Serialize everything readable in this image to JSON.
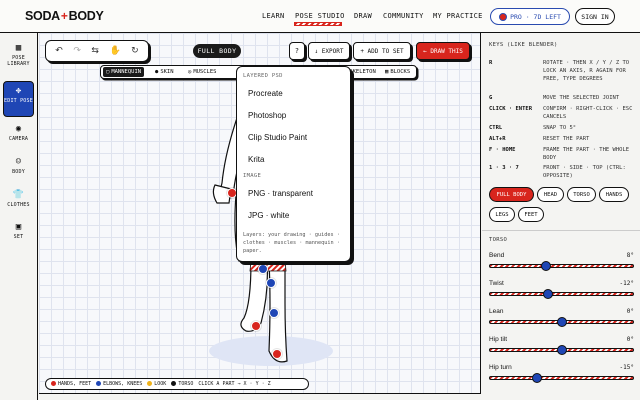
{
  "app": {
    "logo_left": "SODA",
    "logo_plus": "+",
    "logo_right": "BODY"
  },
  "nav": [
    "LEARN",
    "POSE STUDIO",
    "DRAW",
    "COMMUNITY",
    "MY PRACTICE"
  ],
  "nav_active": "POSE STUDIO",
  "pro_badge": "PRO · 7D LEFT",
  "sign_in": "SIGN IN",
  "sidebar": [
    {
      "icon": "grid-icon",
      "glyph": "▦",
      "label": "POSE LIBRARY"
    },
    {
      "icon": "move-icon",
      "glyph": "✥",
      "label": "EDIT POSE",
      "active": true
    },
    {
      "icon": "camera-icon",
      "glyph": "◉",
      "label": "CAMERA"
    },
    {
      "icon": "body-icon",
      "glyph": "☺",
      "label": "BODY"
    },
    {
      "icon": "clothes-icon",
      "glyph": "👕",
      "label": "CLOTHES"
    },
    {
      "icon": "set-icon",
      "glyph": "▣",
      "label": "SET"
    }
  ],
  "toolbox": {
    "undo": "↶",
    "redo": "↷",
    "swap": "⇆",
    "hand": "✋",
    "reset": "↻"
  },
  "view_pill": "FULL BODY",
  "help_btn": "?",
  "export_btn": "↓ EXPORT",
  "add_set_btn": "+ ADD TO SET",
  "draw_btn": "← DRAW THIS",
  "layers": [
    "MANNEQUIN",
    "SKIN",
    "MUSCLES",
    "SKELETON",
    "BLOCKS"
  ],
  "layer_icons": [
    "▢",
    "●",
    "◎",
    "◈",
    "▦"
  ],
  "export_menu": {
    "section1": "LAYERED PSD",
    "psd_items": [
      "Procreate",
      "Photoshop",
      "Clip Studio Paint",
      "Krita"
    ],
    "section2": "IMAGE",
    "image_items": [
      "PNG · transparent",
      "JPG · white"
    ],
    "note": "Layers: your drawing · guides · clothes · muscles · mannequin · paper."
  },
  "legend": {
    "hands_feet": "HANDS, FEET",
    "elbows_knees": "ELBOWS, KNEES",
    "look": "LOOK",
    "torso": "TORSO",
    "hint": "CLICK A PART → X · Y · Z"
  },
  "colors": {
    "red": "#d8251d",
    "blue": "#1f46b5",
    "yellow": "#f0b21a",
    "dark": "#111111"
  },
  "right_panel": {
    "title": "KEYS (LIKE BLENDER)",
    "keys": [
      {
        "key": "R",
        "desc": "ROTATE · THEN X / Y / Z TO LOCK AN AXIS, R AGAIN FOR FREE, TYPE DEGREES"
      },
      {
        "key": "G",
        "desc": "MOVE THE SELECTED JOINT"
      },
      {
        "key": "CLICK · ENTER",
        "desc": "CONFIRM · RIGHT-CLICK · ESC CANCELS"
      },
      {
        "key": "CTRL",
        "desc": "SNAP TO 5°"
      },
      {
        "key": "ALT+R",
        "desc": "RESET THE PART"
      },
      {
        "key": "F · HOME",
        "desc": "FRAME THE PART · THE WHOLE BODY"
      },
      {
        "key": "1 · 3 · 7",
        "desc": "FRONT · SIDE · TOP (CTRL: OPPOSITE)"
      }
    ],
    "chips": [
      "FULL BODY",
      "HEAD",
      "TORSO",
      "HANDS",
      "LEGS",
      "FEET"
    ],
    "active_chip": "FULL BODY",
    "section": "TORSO",
    "sliders": [
      {
        "label": "Bend",
        "value": "8°",
        "fraction": 0.39
      },
      {
        "label": "Twist",
        "value": "-12°",
        "fraction": 0.41
      },
      {
        "label": "Lean",
        "value": "0°",
        "fraction": 0.5
      },
      {
        "label": "Hip tilt",
        "value": "0°",
        "fraction": 0.5
      },
      {
        "label": "Hip turn",
        "value": "-15°",
        "fraction": 0.33
      }
    ]
  }
}
